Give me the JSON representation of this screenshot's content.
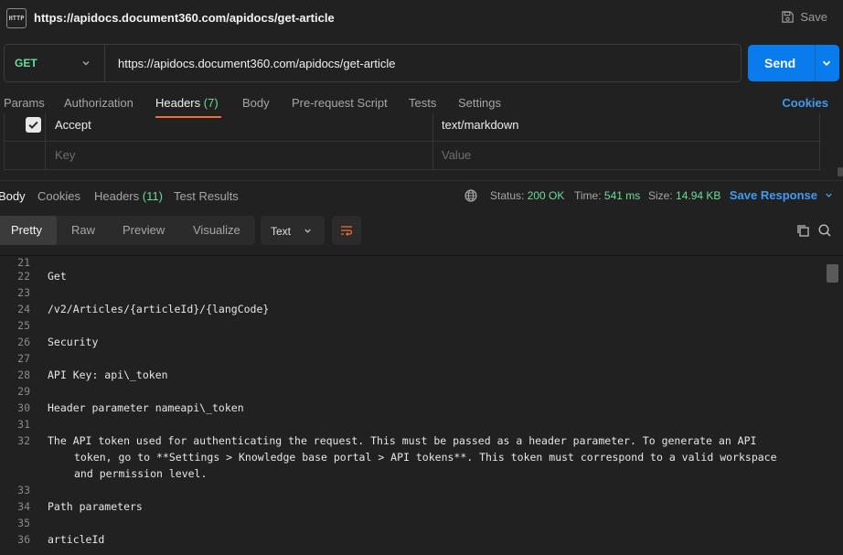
{
  "window": {
    "title": "https://apidocs.document360.com/apidocs/get-article",
    "save_label": "Save"
  },
  "request": {
    "method": "GET",
    "url": "https://apidocs.document360.com/apidocs/get-article",
    "send_label": "Send"
  },
  "request_tabs": [
    {
      "label": "Params"
    },
    {
      "label": "Authorization"
    },
    {
      "label": "Headers",
      "count": "(7)"
    },
    {
      "label": "Body"
    },
    {
      "label": "Pre-request Script"
    },
    {
      "label": "Tests"
    },
    {
      "label": "Settings"
    }
  ],
  "cookies_label": "Cookies",
  "headers_table": {
    "rows": [
      {
        "key": "Accept",
        "value": "text/markdown",
        "checked": true
      }
    ],
    "key_placeholder": "Key",
    "value_placeholder": "Value"
  },
  "response_tabs": [
    {
      "label": "Body"
    },
    {
      "label": "Cookies"
    },
    {
      "label": "Headers",
      "count": "(11)"
    },
    {
      "label": "Test Results"
    }
  ],
  "response_status": {
    "status_label": "Status:",
    "status_value": "200 OK",
    "time_label": "Time:",
    "time_value": "541 ms",
    "size_label": "Size:",
    "size_value": "14.94 KB",
    "save_response_label": "Save Response"
  },
  "view_modes": [
    {
      "label": "Pretty"
    },
    {
      "label": "Raw"
    },
    {
      "label": "Preview"
    },
    {
      "label": "Visualize"
    }
  ],
  "format_label": "Text",
  "code_lines": [
    {
      "num": "21",
      "text": ""
    },
    {
      "num": "22",
      "text": "Get"
    },
    {
      "num": "23",
      "text": ""
    },
    {
      "num": "24",
      "text": "/v2/Articles/{articleId}/{langCode}"
    },
    {
      "num": "25",
      "text": ""
    },
    {
      "num": "26",
      "text": "Security"
    },
    {
      "num": "27",
      "text": ""
    },
    {
      "num": "28",
      "text": "API Key: api\\_token"
    },
    {
      "num": "29",
      "text": ""
    },
    {
      "num": "30",
      "text": "Header parameter nameapi\\_token"
    },
    {
      "num": "31",
      "text": ""
    },
    {
      "num": "32",
      "text": "The API token used for authenticating the request. This must be passed as a header parameter. To generate an API",
      "cont1": "token, go to **Settings > Knowledge base portal > API tokens**. This token must correspond to a valid workspace",
      "cont2": "and permission level."
    },
    {
      "num": "33",
      "text": ""
    },
    {
      "num": "34",
      "text": "Path parameters"
    },
    {
      "num": "35",
      "text": ""
    },
    {
      "num": "36",
      "text": "articleId"
    }
  ],
  "colors": {
    "accent": "#097bed",
    "success": "#6bdd9a",
    "tab_indicator": "#f26b3a",
    "link": "#3f9cf2"
  }
}
